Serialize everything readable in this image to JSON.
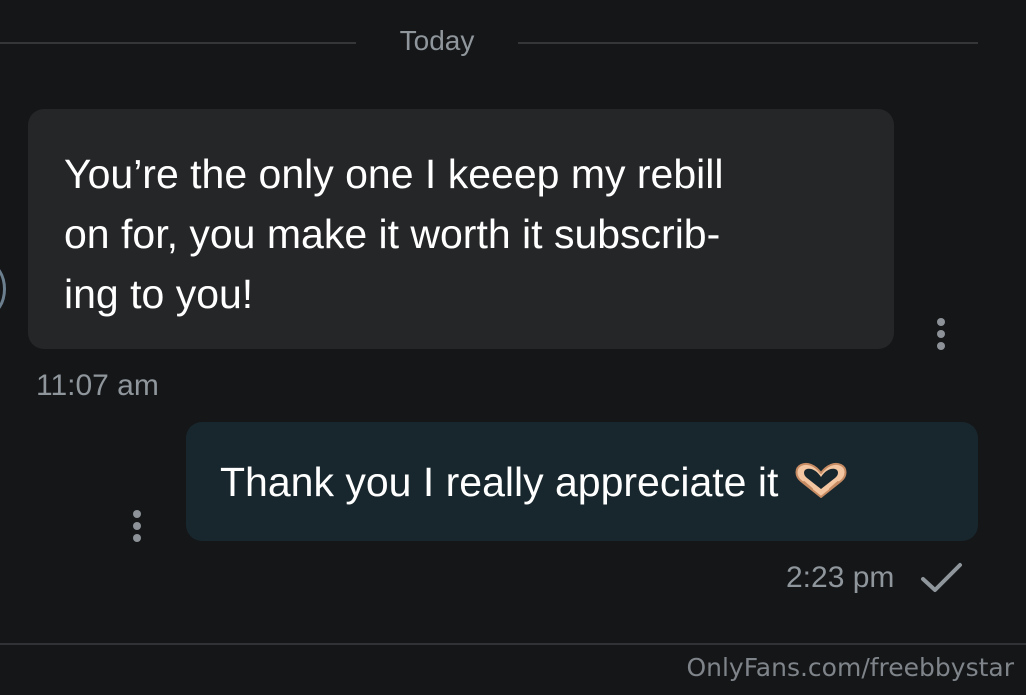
{
  "date_divider": {
    "label": "Today"
  },
  "messages": [
    {
      "direction": "incoming",
      "lines": [
        "You’re the only one I keeep my rebill",
        "on for, you make it worth it subscrib-",
        "ing to you!"
      ],
      "time": "11:07 am",
      "more_icon": "more-vertical-icon"
    },
    {
      "direction": "outgoing",
      "text": "Thank you I really appreciate it",
      "emoji_icon": "heart-hands-emoji-icon",
      "time": "2:23 pm",
      "status_icon": "check-icon",
      "more_icon": "more-vertical-icon"
    }
  ],
  "watermark": "OnlyFans.com/freebbystar",
  "colors": {
    "background": "#151618",
    "incoming_bubble": "#252628",
    "outgoing_bubble": "#18272e",
    "muted_text": "#8f969c"
  }
}
